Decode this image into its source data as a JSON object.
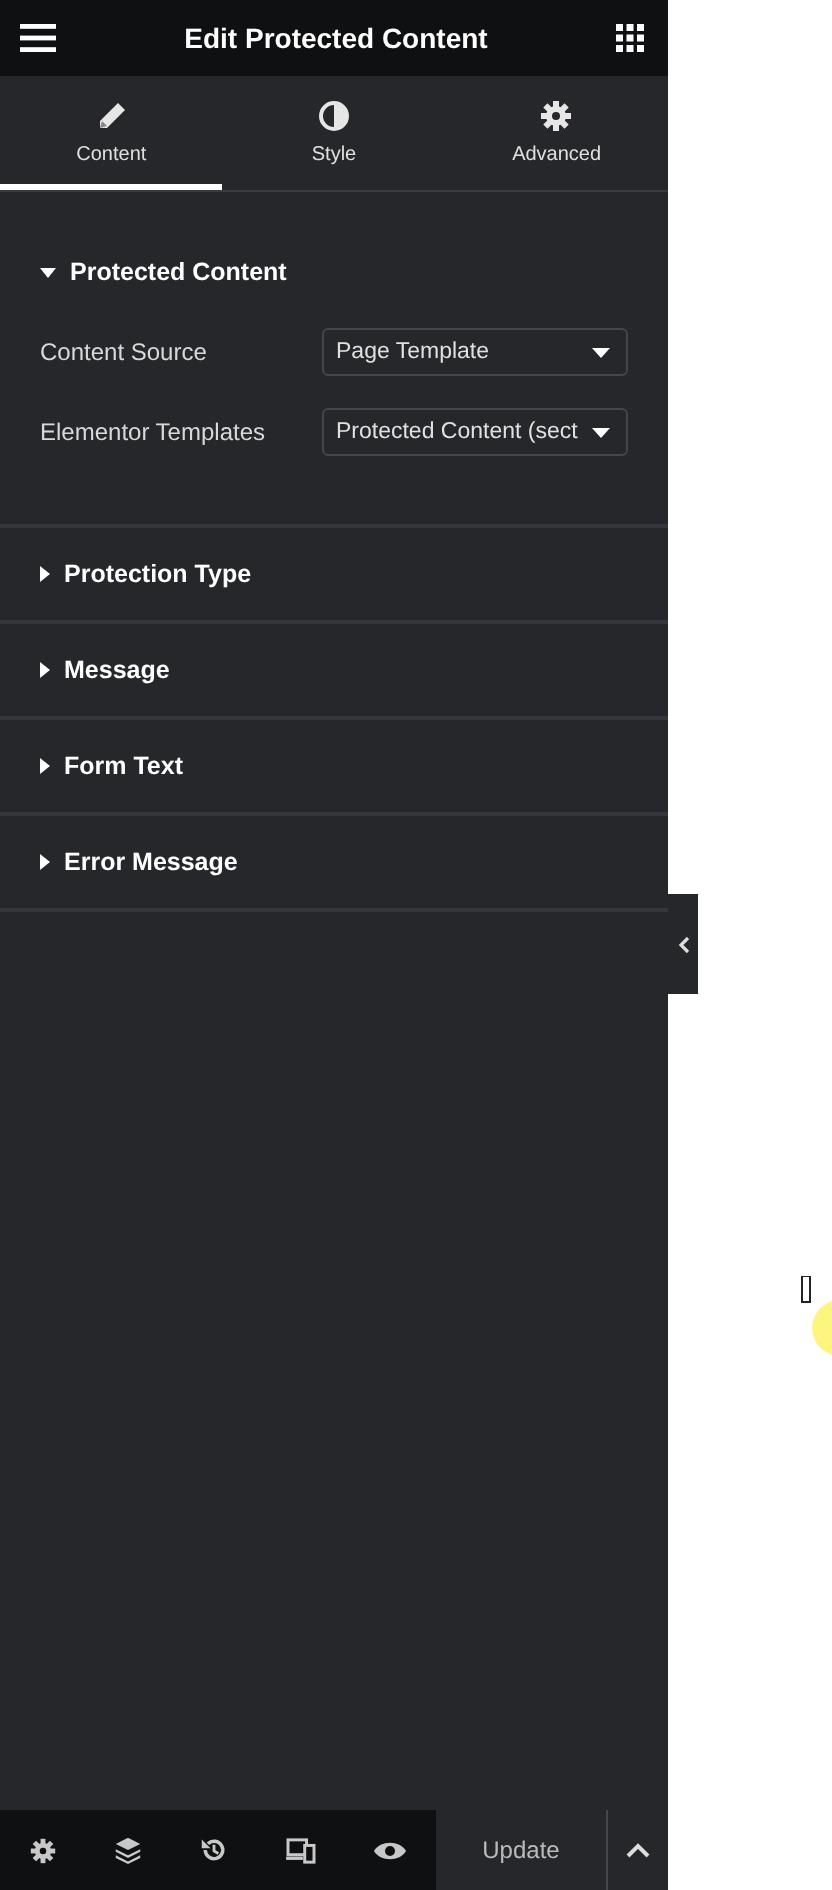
{
  "header": {
    "title": "Edit Protected Content"
  },
  "tabs": [
    {
      "label": "Content",
      "selected": true
    },
    {
      "label": "Style",
      "selected": false
    },
    {
      "label": "Advanced",
      "selected": false
    }
  ],
  "sections": [
    {
      "title": "Protected Content",
      "expanded": true,
      "controls": [
        {
          "label": "Content Source",
          "value": "Page Template"
        },
        {
          "label": "Elementor Templates",
          "value": "Protected Content (sect"
        }
      ]
    },
    {
      "title": "Protection Type",
      "expanded": false
    },
    {
      "title": "Message",
      "expanded": false
    },
    {
      "title": "Form Text",
      "expanded": false
    },
    {
      "title": "Error Message",
      "expanded": false
    }
  ],
  "footer": {
    "update_button": "Update"
  }
}
